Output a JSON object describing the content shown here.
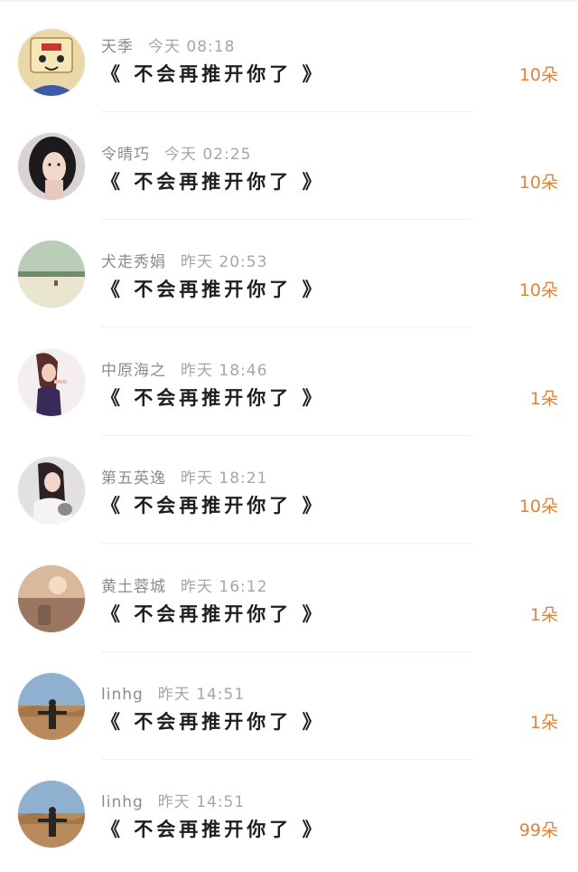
{
  "entries": [
    {
      "name": "天季",
      "time": "今天 08:18",
      "message": "《 不会再推开你了 》",
      "count": "10朵"
    },
    {
      "name": "令晴巧",
      "time": "今天 02:25",
      "message": "《 不会再推开你了 》",
      "count": "10朵"
    },
    {
      "name": "犬走秀娟",
      "time": "昨天 20:53",
      "message": "《 不会再推开你了 》",
      "count": "10朵"
    },
    {
      "name": "中原海之",
      "time": "昨天 18:46",
      "message": "《 不会再推开你了 》",
      "count": "1朵"
    },
    {
      "name": "第五英逸",
      "time": "昨天 18:21",
      "message": "《 不会再推开你了 》",
      "count": "10朵"
    },
    {
      "name": "黄土蓉城",
      "time": "昨天 16:12",
      "message": "《 不会再推开你了 》",
      "count": "1朵"
    },
    {
      "name": "linhg",
      "time": "昨天 14:51",
      "message": "《 不会再推开你了 》",
      "count": "1朵"
    },
    {
      "name": "linhg",
      "time": "昨天 14:51",
      "message": "《 不会再推开你了 》",
      "count": "99朵"
    }
  ],
  "colors": {
    "count": "#e0833a",
    "name": "#8c8c8c",
    "message": "#1e1e1e"
  }
}
